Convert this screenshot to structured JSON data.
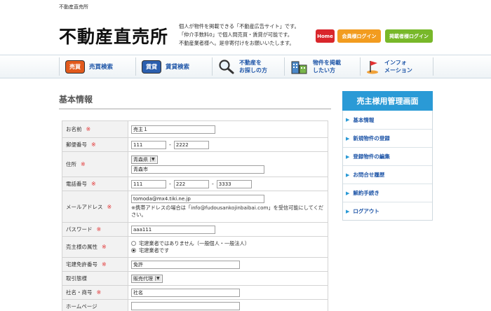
{
  "top": {
    "site_name": "不動産直売所"
  },
  "header": {
    "logo": "不動産直売所",
    "tagline": [
      "個人が物件を掲載できる「不動産広告サイト」です。",
      "「仲介手数料0」で個人間売買・賃貸が可能です。",
      "不動産業者様へ。是非寄付けをお願いいたします。"
    ],
    "buttons": {
      "home": "Home",
      "member": "会員様ログイン",
      "listing": "掲載者様ログイン"
    }
  },
  "nav": {
    "sale_pill": "売買",
    "sale_label": "売買検索",
    "rent_pill": "賃貸",
    "rent_label": "賃貸検索",
    "search_line1": "不動産を",
    "search_line2": "お探しの方",
    "post_line1": "物件を掲載",
    "post_line2": "したい方",
    "info_line1": "インフォ",
    "info_line2": "メーション"
  },
  "page": {
    "title": "基本情報"
  },
  "form": {
    "required_mark": "※",
    "name_label": "お名前",
    "name_value": "売主１",
    "postal_label": "郵便番号",
    "postal_1": "111",
    "postal_2": "2222",
    "address_label": "住所",
    "prefecture": "青森県",
    "city": "青森市",
    "phone_label": "電話番号",
    "phone_1": "111",
    "phone_2": "222",
    "phone_3": "3333",
    "email_label": "メールアドレス",
    "email_value": "tomoda@mx4.tiki.ne.jp",
    "email_note": "※携帯アドレスの場合は「info@fudousankojinbaibai.com」を受信可能にしてください。",
    "password_label": "パスワード",
    "password_value": "aaa111",
    "attr_label": "売主様の属性",
    "attr_opt1": "宅建業者ではありません（一般個人・一般法人）",
    "attr_opt2": "宅建業者です",
    "license_label": "宅建免許番号",
    "license_value": "免許",
    "deal_label": "取引態様",
    "deal_value": "販売代理",
    "company_label": "社名・商号",
    "company_value": "社名",
    "extra_label": "ホームページ"
  },
  "sidebar": {
    "title": "売主様用管理画面",
    "items": [
      "基本情報",
      "新規物件の登録",
      "登録物件の編集",
      "お問合せ履歴",
      "解約手続き",
      "ログアウト"
    ]
  }
}
